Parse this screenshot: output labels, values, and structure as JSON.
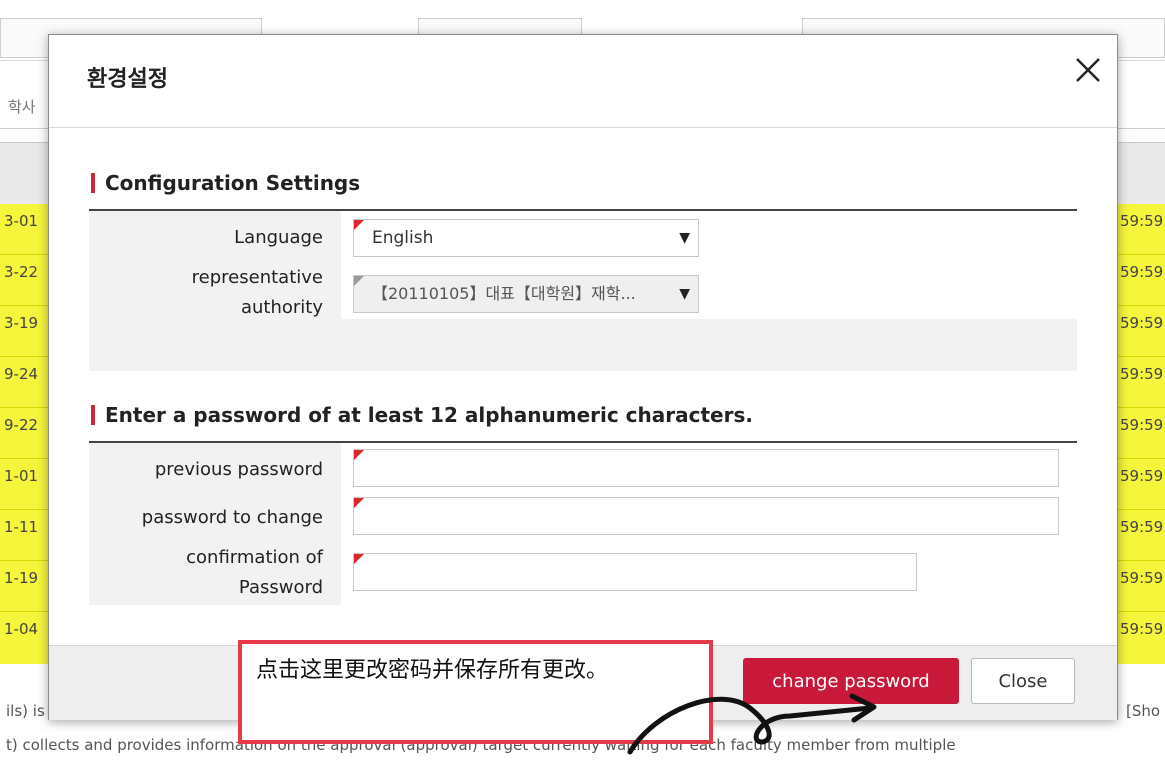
{
  "background": {
    "breadcrumb": "학사",
    "left_cells": [
      "3-01",
      "3-22",
      "3-19",
      "9-24",
      "9-22",
      "1-01",
      "1-11",
      "1-19",
      "1-04"
    ],
    "right_cells": [
      "59:59",
      "59:59",
      "59:59",
      "59:59",
      "59:59",
      "59:59",
      "59:59",
      "59:59",
      "59:59"
    ],
    "note_line1": "ils) is",
    "note_line1_right": "[Sho",
    "note_line2": "t) collects and provides information on the approval (approval) target currently waiting for each faculty member from multiple",
    "highlight_color": "#f5f53c"
  },
  "modal": {
    "title": "환경설정",
    "close_icon": "close-icon",
    "config_section": {
      "title": "Configuration Settings",
      "language_label": "Language",
      "language_value": "English",
      "authority_label_line1": "representative",
      "authority_label_line2": "authority",
      "authority_value": "【20110105】대표【대학원】재학..."
    },
    "password_section": {
      "title": "Enter a password of at least 12 alphanumeric characters.",
      "previous_label": "previous password",
      "previous_value": "",
      "change_label": "password to change",
      "change_value": "",
      "confirm_label_line1": "confirmation of",
      "confirm_label_line2": "Password",
      "confirm_value": ""
    },
    "buttons": {
      "change_password": "change password",
      "close": "Close"
    },
    "accent_color": "#c8193a"
  },
  "annotation": {
    "text": "点击这里更改密码并保存所有更改。",
    "border_color": "#e43a4a"
  }
}
